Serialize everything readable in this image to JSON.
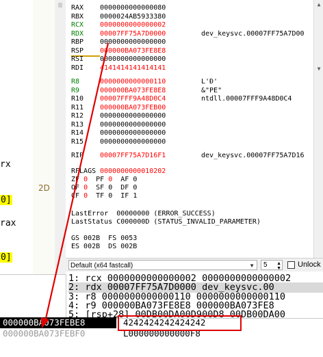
{
  "left_pane": {
    "fragments": [
      "rx",
      "0]",
      "rax",
      "0]"
    ],
    "badge": "2D"
  },
  "registers": {
    "general": [
      {
        "name": "RAX",
        "value": "0000000000000080",
        "info": "",
        "changed": false
      },
      {
        "name": "RBX",
        "value": "0000024AB5933380",
        "info": "",
        "changed": false
      },
      {
        "name": "RCX",
        "value": "0000000000000002",
        "info": "",
        "changed": true,
        "name_green": true
      },
      {
        "name": "RDX",
        "value": "00007FF75A7D0000",
        "info": "dev_keysvc.00007FF75A7D00",
        "changed": true,
        "name_green": true
      },
      {
        "name": "RBP",
        "value": "0000000000000000",
        "info": "",
        "changed": false
      },
      {
        "name": "RSP",
        "value": "000000BA073FE8E8",
        "info": "",
        "changed": true
      },
      {
        "name": "RSI",
        "value": "0000000000000000",
        "info": "",
        "changed": false
      },
      {
        "name": "RDI",
        "value": "4141414141414141",
        "info": "",
        "changed": true
      }
    ],
    "extended": [
      {
        "name": "R8",
        "value": "0000000000000110",
        "info": "L'Ð'",
        "changed": true,
        "name_green": true
      },
      {
        "name": "R9",
        "value": "000000BA073FE8E8",
        "info": "&\"PE\"",
        "changed": true,
        "name_green": true
      },
      {
        "name": "R10",
        "value": "00007FFF9A48D0C4",
        "info": "ntdll.00007FFF9A48D0C4",
        "changed": true
      },
      {
        "name": "R11",
        "value": "000000BA073FEB00",
        "info": "",
        "changed": true
      },
      {
        "name": "R12",
        "value": "0000000000000000",
        "info": "",
        "changed": false
      },
      {
        "name": "R13",
        "value": "0000000000000000",
        "info": "",
        "changed": false
      },
      {
        "name": "R14",
        "value": "0000000000000000",
        "info": "",
        "changed": false
      },
      {
        "name": "R15",
        "value": "0000000000000000",
        "info": "",
        "changed": false
      }
    ],
    "rip": {
      "name": "RIP",
      "value": "00007FF75A7D16F1",
      "info": "dev_keysvc.00007FF75A7D16"
    },
    "rflags": {
      "name": "RFLAGS",
      "value": "0000000000010202"
    },
    "flags": [
      [
        {
          "n": "ZF",
          "v": "0"
        },
        {
          "n": "PF",
          "v": "0"
        },
        {
          "n": "AF",
          "v": "0"
        }
      ],
      [
        {
          "n": "OF",
          "v": "0"
        },
        {
          "n": "SF",
          "v": "0"
        },
        {
          "n": "DF",
          "v": "0"
        }
      ],
      [
        {
          "n": "CF",
          "v": "0"
        },
        {
          "n": "TF",
          "v": "0"
        },
        {
          "n": "IF",
          "v": "1"
        }
      ]
    ],
    "last_error": "LastError  00000000 (ERROR_SUCCESS)",
    "last_status": "LastStatus C000000D (STATUS_INVALID_PARAMETER)",
    "segments": [
      "GS 002B  FS 0053",
      "ES 002B  DS 002B"
    ]
  },
  "conv_bar": {
    "calling_convention": "Default (x64 fastcall)",
    "arg_count": "5",
    "unlock_label": "Unlock"
  },
  "args": [
    "1: rcx 0000000000000002 0000000000000002",
    "2: rdx 00007FF75A7D0000 dev_keysvc.00",
    "3: r8 0000000000000110 0000000000000110",
    "4: r9 000000BA073FE8E8 000000BA073FE8",
    "5: [rsp+28] 00DB00DA00D900D8 00DB00DA00"
  ],
  "stack": {
    "selected_addr": "000000BA073FEBE8",
    "selected_val": "4242424242424242",
    "next_addr": "000000BA073FEBF0",
    "next_val": "L000000000000F8"
  },
  "colors": {
    "changed": "#ff0000",
    "name_green": "#008000",
    "annotation": "#e00000"
  }
}
